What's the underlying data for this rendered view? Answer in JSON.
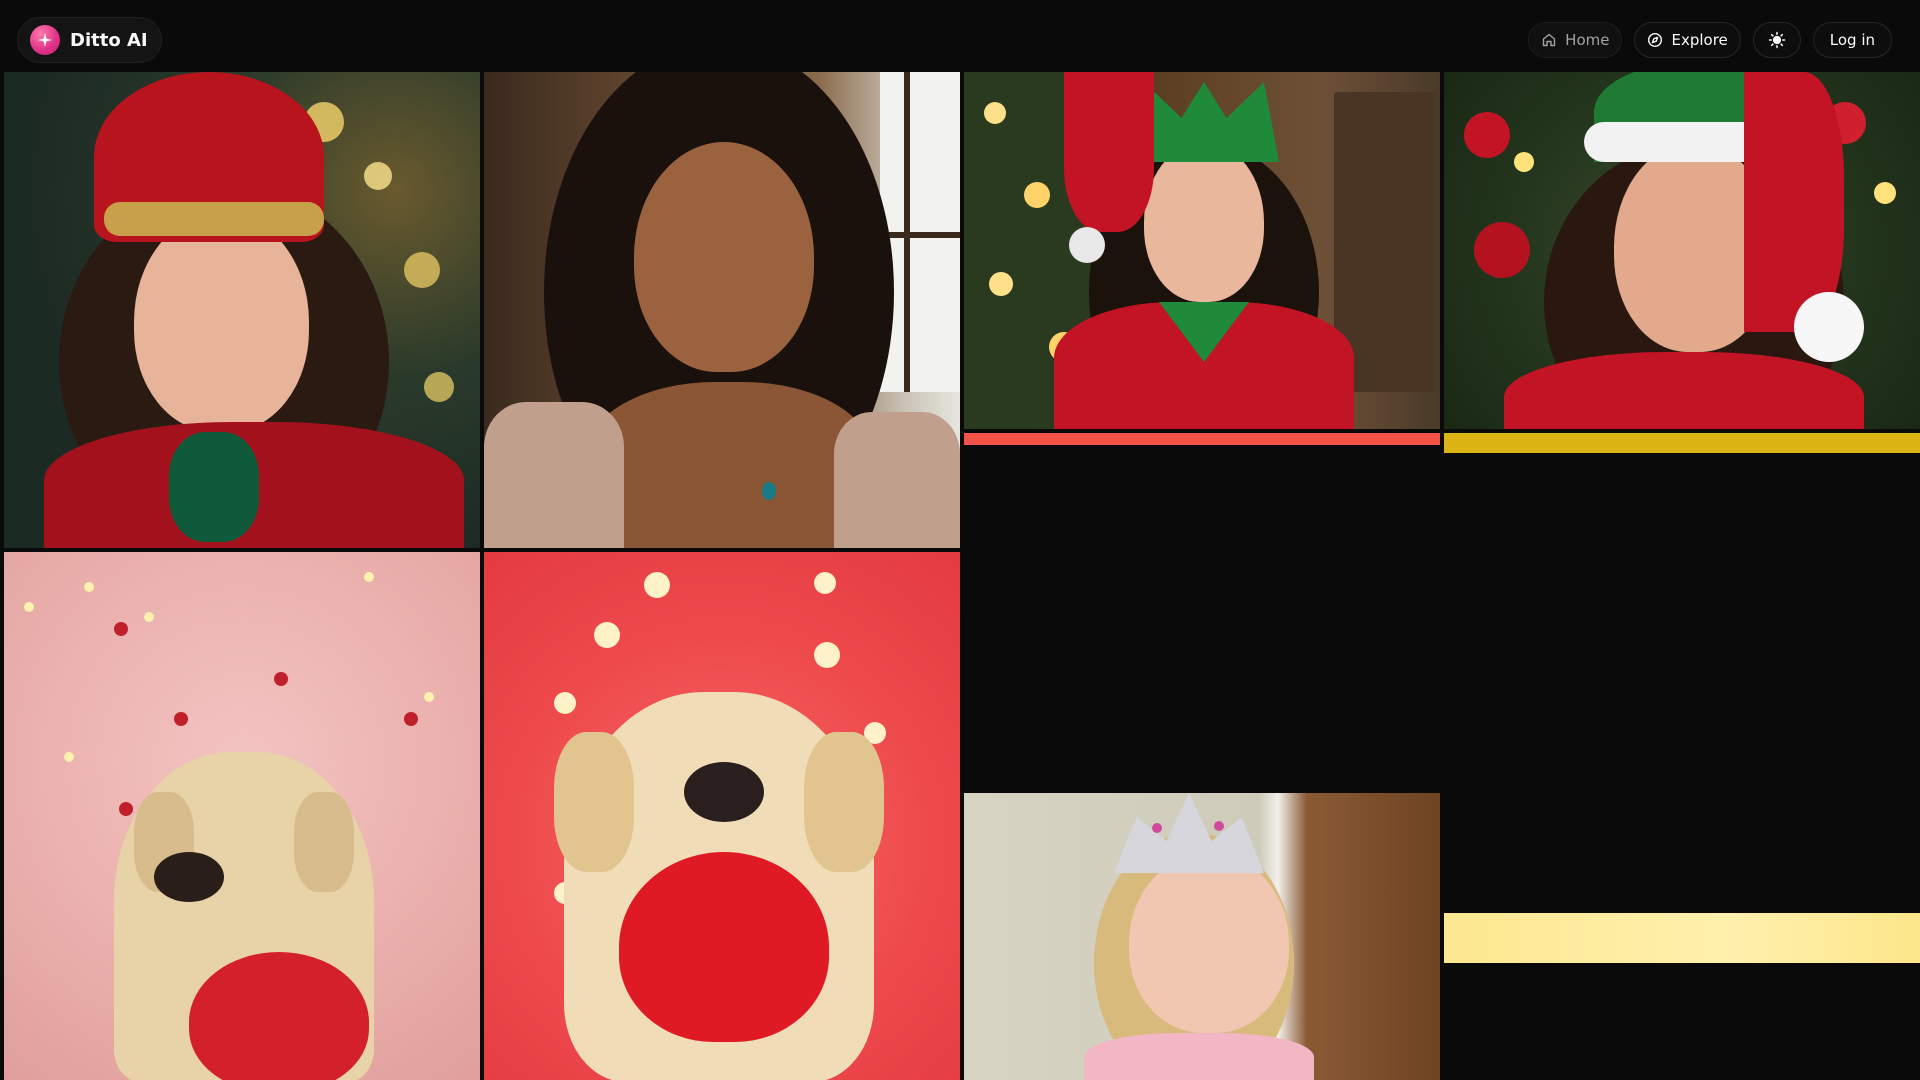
{
  "app": {
    "name": "Ditto AI",
    "logo_icon": "sparkle-icon",
    "accent_color": "#e0358a"
  },
  "nav": {
    "home_label": "Home",
    "home_icon": "home-icon",
    "explore_label": "Explore",
    "explore_icon": "compass-icon",
    "theme_icon": "sun-icon",
    "login_label": "Log in"
  },
  "gallery": {
    "items": [
      {
        "subject": "elf-portrait-red-hat",
        "accent": "#b8141e"
      },
      {
        "subject": "portrait-wavy-hair",
        "accent": "#6b4c32"
      },
      {
        "subject": "elf-portrait-green-hat",
        "accent": "#1f8a3a"
      },
      {
        "subject": "elf-portrait-santa-hat",
        "accent": "#c21424"
      },
      {
        "subject": "dog-with-heart-pink",
        "accent": "#eab0ad"
      },
      {
        "subject": "dog-with-heart-red",
        "accent": "#ee4a4c"
      },
      {
        "subject": "girl-with-tiara",
        "accent": "#cfcbbb"
      }
    ],
    "placeholders": [
      {
        "color": "#f25346"
      },
      {
        "color": "#dcb414"
      },
      {
        "color": "#fde78f"
      }
    ]
  }
}
